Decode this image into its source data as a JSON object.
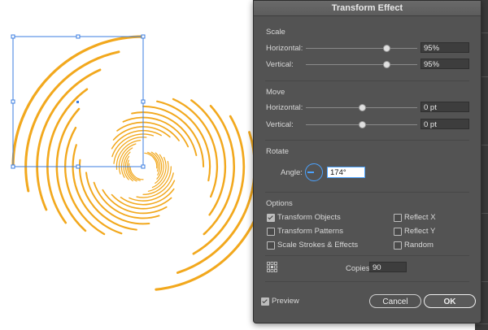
{
  "dialog": {
    "title": "Transform Effect"
  },
  "scale": {
    "title": "Scale",
    "horizontal": {
      "label": "Horizontal:",
      "value": "95%",
      "level": 0.72
    },
    "vertical": {
      "label": "Vertical:",
      "value": "95%",
      "level": 0.72
    }
  },
  "move": {
    "title": "Move",
    "horizontal": {
      "label": "Horizontal:",
      "value": "0 pt",
      "level": 0.5
    },
    "vertical": {
      "label": "Vertical:",
      "value": "0 pt",
      "level": 0.5
    }
  },
  "rotate": {
    "title": "Rotate",
    "angle_label": "Angle:",
    "angle_value": "174°"
  },
  "options": {
    "title": "Options",
    "transform_objects": {
      "label": "Transform Objects",
      "checked": true
    },
    "transform_patterns": {
      "label": "Transform Patterns",
      "checked": false
    },
    "scale_strokes": {
      "label": "Scale Strokes & Effects",
      "checked": false
    },
    "reflect_x": {
      "label": "Reflect X",
      "checked": false
    },
    "reflect_y": {
      "label": "Reflect Y",
      "checked": false
    },
    "random": {
      "label": "Random",
      "checked": false
    }
  },
  "reference_point_icon": "reference-point-grid-icon",
  "copies": {
    "label": "Copies",
    "value": "90"
  },
  "preview": {
    "label": "Preview",
    "checked": true
  },
  "buttons": {
    "cancel": "Cancel",
    "ok": "OK"
  },
  "colors": {
    "spiral_stroke": "#F2A81D",
    "selection": "#3b7de0",
    "dialog_bg": "#535353",
    "accent": "#4ba3ff"
  }
}
